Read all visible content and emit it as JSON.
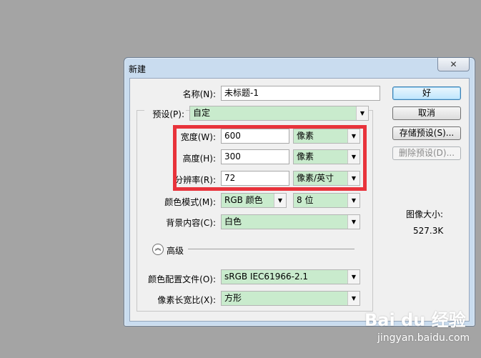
{
  "window": {
    "title": "新建",
    "close_icon": "✕"
  },
  "form": {
    "name": {
      "label": "名称(N):",
      "value": "未标题-1"
    },
    "preset": {
      "label": "预设(P):",
      "value": "自定"
    },
    "width": {
      "label": "宽度(W):",
      "value": "600",
      "unit": "像素"
    },
    "height": {
      "label": "高度(H):",
      "value": "300",
      "unit": "像素"
    },
    "resolution": {
      "label": "分辨率(R):",
      "value": "72",
      "unit": "像素/英寸"
    },
    "color_mode": {
      "label": "颜色模式(M):",
      "value": "RGB 颜色",
      "depth": "8 位"
    },
    "background": {
      "label": "背景内容(C):",
      "value": "白色"
    },
    "advanced": {
      "label": "高级"
    },
    "color_profile": {
      "label": "颜色配置文件(O):",
      "value": "sRGB IEC61966-2.1"
    },
    "pixel_aspect": {
      "label": "像素长宽比(X):",
      "value": "方形"
    }
  },
  "buttons": {
    "ok": "好",
    "cancel": "取消",
    "save_preset": "存储预设(S)...",
    "delete_preset": "删除预设(D)..."
  },
  "image_size": {
    "label": "图像大小:",
    "value": "527.3K"
  },
  "watermark": {
    "brand": "Bai du 经验",
    "sub": "jingyan.baidu.com"
  },
  "colors": {
    "highlight": "#e8333b",
    "select_bg": "#c9ebcd",
    "desktop": "#a4a4a4"
  }
}
